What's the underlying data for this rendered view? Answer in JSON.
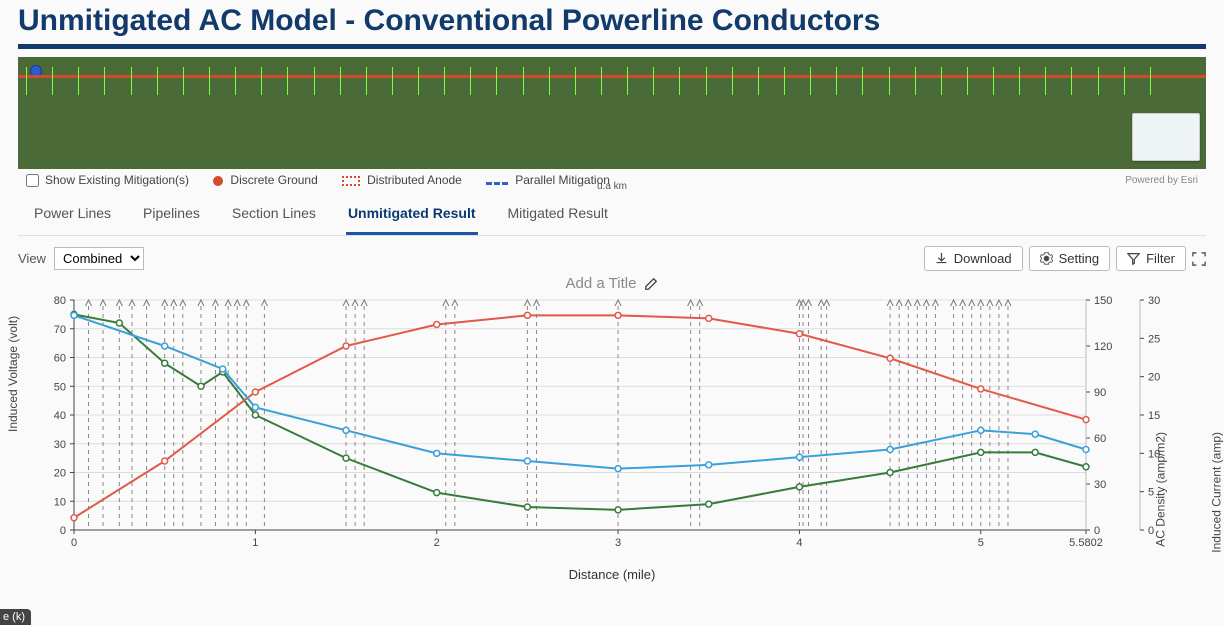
{
  "page": {
    "title": "Unmitigated AC Model - Conventional Powerline Conductors"
  },
  "map": {
    "legend": {
      "show_existing_label": "Show Existing Mitigation(s)",
      "discrete_ground": "Discrete Ground",
      "distributed_anode": "Distributed Anode",
      "parallel_mitigation": "Parallel Mitigation",
      "scale": "u.a km",
      "powered_by": "Powered by Esri"
    }
  },
  "tabs": [
    {
      "id": "powerlines",
      "label": "Power Lines"
    },
    {
      "id": "pipelines",
      "label": "Pipelines"
    },
    {
      "id": "sectionlines",
      "label": "Section Lines"
    },
    {
      "id": "unmitigated",
      "label": "Unmitigated Result"
    },
    {
      "id": "mitigated",
      "label": "Mitigated Result"
    }
  ],
  "active_tab": "unmitigated",
  "toolbar": {
    "view_label": "View",
    "view_value": "Combined",
    "download": "Download",
    "setting": "Setting",
    "filter": "Filter"
  },
  "chart_title_placeholder": "Add a Title",
  "footer_chip": "e (k)",
  "chart_data": {
    "type": "line",
    "xlabel": "Distance (mile)",
    "y_left_label": "Induced Voltage (volt)",
    "y_right2_label": "AC Density (amp/m2)",
    "y_right_label": "Induced Current (amp)",
    "x_ticks": [
      0,
      1,
      2,
      3,
      4,
      5,
      5.5802
    ],
    "y_left_ticks": [
      0,
      10,
      20,
      30,
      40,
      50,
      60,
      70,
      80
    ],
    "y_right2_ticks": [
      0,
      30,
      60,
      90,
      120,
      150
    ],
    "y_right_ticks": [
      0,
      5,
      10,
      15,
      20,
      25,
      30
    ],
    "x_range": [
      0,
      5.5802
    ],
    "y_left_range": [
      0,
      80
    ],
    "y_right2_range": [
      0,
      150
    ],
    "y_right_range": [
      0,
      30
    ],
    "series": [
      {
        "name": "Induced Voltage",
        "axis": "left",
        "color": "#387a3a",
        "x": [
          0,
          0.25,
          0.5,
          0.7,
          0.82,
          1,
          1.5,
          2,
          2.5,
          3,
          3.5,
          4,
          4.5,
          5,
          5.3,
          5.5802
        ],
        "y": [
          75,
          72,
          58,
          50,
          55,
          40,
          25,
          13,
          8,
          7,
          9,
          15,
          20,
          27,
          27,
          22
        ]
      },
      {
        "name": "AC Density",
        "axis": "right2",
        "color": "#e15a49",
        "x": [
          0,
          0.5,
          1,
          1.5,
          2,
          2.5,
          3,
          3.5,
          4,
          4.5,
          5,
          5.5802
        ],
        "y": [
          8,
          45,
          90,
          120,
          134,
          140,
          140,
          138,
          128,
          112,
          92,
          72
        ]
      },
      {
        "name": "Induced Current",
        "axis": "right",
        "color": "#3aa0d9",
        "x": [
          0,
          0.5,
          0.82,
          1,
          1.5,
          2,
          2.5,
          3,
          3.5,
          4,
          4.5,
          5,
          5.3,
          5.5802
        ],
        "y": [
          28,
          24,
          21,
          16,
          13,
          10,
          9,
          8,
          8.5,
          9.5,
          10.5,
          13,
          12.5,
          10.5
        ]
      }
    ],
    "vdash_x": [
      0.08,
      0.16,
      0.25,
      0.32,
      0.4,
      0.5,
      0.55,
      0.6,
      0.7,
      0.78,
      0.85,
      0.9,
      0.95,
      1.05,
      1.5,
      1.55,
      1.6,
      2.05,
      2.1,
      2.5,
      2.55,
      3.0,
      3.4,
      3.45,
      4.0,
      4.02,
      4.05,
      4.12,
      4.15,
      4.5,
      4.55,
      4.6,
      4.65,
      4.7,
      4.75,
      4.85,
      4.9,
      4.95,
      5.0,
      5.05,
      5.1,
      5.15
    ]
  }
}
